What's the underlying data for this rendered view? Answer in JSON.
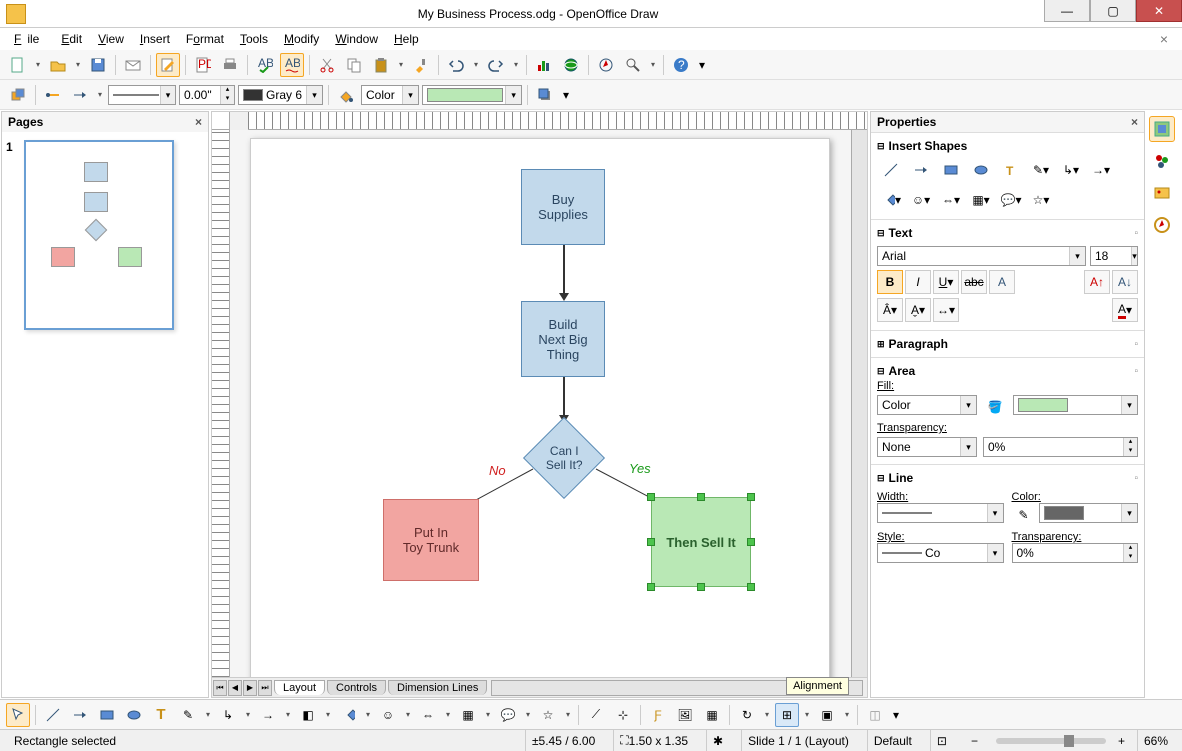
{
  "window": {
    "title": "My Business Process.odg - OpenOffice Draw",
    "btn_min": "—",
    "btn_max": "▢",
    "btn_close": "✕"
  },
  "menubar": {
    "file": "File",
    "edit": "Edit",
    "view": "View",
    "insert": "Insert",
    "format": "Format",
    "tools": "Tools",
    "modify": "Modify",
    "window": "Window",
    "help": "Help",
    "file_u": "F",
    "edit_u": "E",
    "view_u": "V",
    "insert_u": "I",
    "format_u": "o",
    "tools_u": "T",
    "modify_u": "M",
    "window_u": "W",
    "help_u": "H"
  },
  "toolbar2": {
    "line_width": "0.00\"",
    "line_color": "Gray 6",
    "fill_mode": "Color"
  },
  "pages_panel": {
    "title": "Pages",
    "slide_num": "1"
  },
  "flow": {
    "box1": "Buy\nSupplies",
    "box2": "Build\nNext Big\nThing",
    "diamond": "Can I\nSell It?",
    "box_no": "Put In\nToy Trunk",
    "box_yes": "Then Sell It",
    "label_no": "No",
    "label_yes": "Yes"
  },
  "tabs": {
    "layout": "Layout",
    "controls": "Controls",
    "dimlines": "Dimension Lines"
  },
  "tooltip": "Alignment",
  "properties": {
    "title": "Properties",
    "insert_shapes": "Insert Shapes",
    "text": "Text",
    "font_name": "Arial",
    "font_size": "18",
    "paragraph": "Paragraph",
    "area": "Area",
    "fill_label": "Fill:",
    "fill_mode": "Color",
    "transparency_label": "Transparency:",
    "transp_mode": "None",
    "transp_value": "0%",
    "line": "Line",
    "width_label": "Width:",
    "color_label": "Color:",
    "style_label": "Style:",
    "line_style_value": "Co",
    "line_transp": "0%"
  },
  "status": {
    "sel": "Rectangle selected",
    "pos": "5.45 / 6.00",
    "size": "1.50 x 1.35",
    "slide": "Slide 1 / 1 (Layout)",
    "style": "Default",
    "zoom": "66%"
  }
}
